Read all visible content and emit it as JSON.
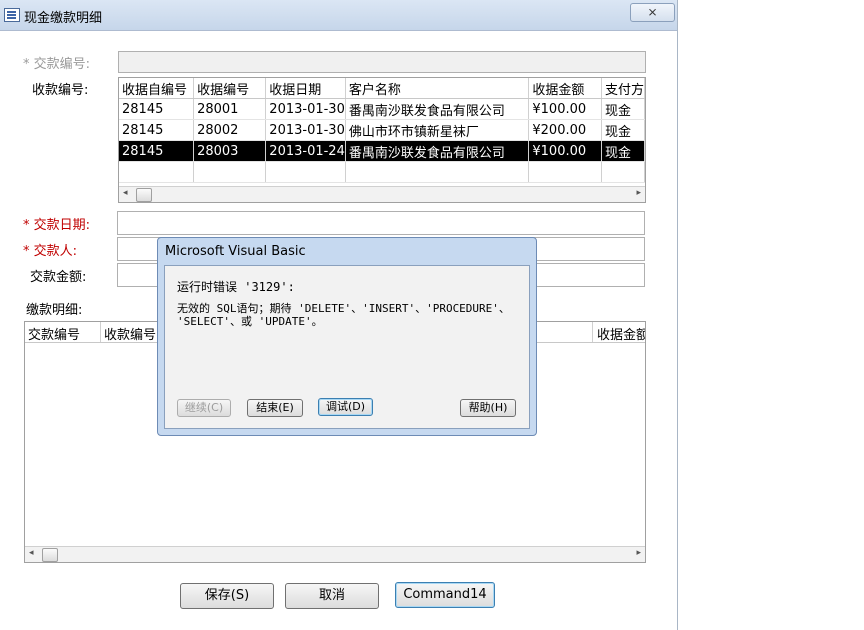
{
  "window": {
    "title": "现金缴款明细",
    "close_label": "⨯"
  },
  "form": {
    "payment_no_label": "* 交款编号:",
    "receipt_no_label": "收款编号:",
    "pay_date_label": "* 交款日期:",
    "payer_label": "* 交款人:",
    "amount_label": "交款金额:",
    "details_label": "缴款明细:"
  },
  "receipt_list": {
    "columns": [
      "收据自编号",
      "收据编号",
      "收据日期",
      "客户名称",
      "收据金额",
      "支付方"
    ],
    "rows": [
      [
        "28145",
        "28001",
        "2013-01-30",
        "番禺南沙联发食品有限公司",
        "¥100.00",
        "现金"
      ],
      [
        "28145",
        "28002",
        "2013-01-30",
        "佛山市环市镇新星袜厂",
        "¥200.00",
        "现金"
      ],
      [
        "28145",
        "28003",
        "2013-01-24",
        "番禺南沙联发食品有限公司",
        "¥100.00",
        "现金"
      ]
    ],
    "selected_row": 2
  },
  "details_list": {
    "columns": [
      "交款编号",
      "收款编号",
      "收据金额"
    ]
  },
  "buttons": {
    "save": "保存(S)",
    "cancel": "取消",
    "command14": "Command14"
  },
  "dialog": {
    "title": "Microsoft Visual Basic",
    "error_line": "运行时错误 '3129':",
    "message": "无效的 SQL语句；期待 'DELETE'、'INSERT'、'PROCEDURE'、\n'SELECT'、或 'UPDATE'。",
    "buttons": {
      "continue": "继续(C)",
      "end": "结束(E)",
      "debug": "调试(D)",
      "help": "帮助(H)"
    }
  }
}
